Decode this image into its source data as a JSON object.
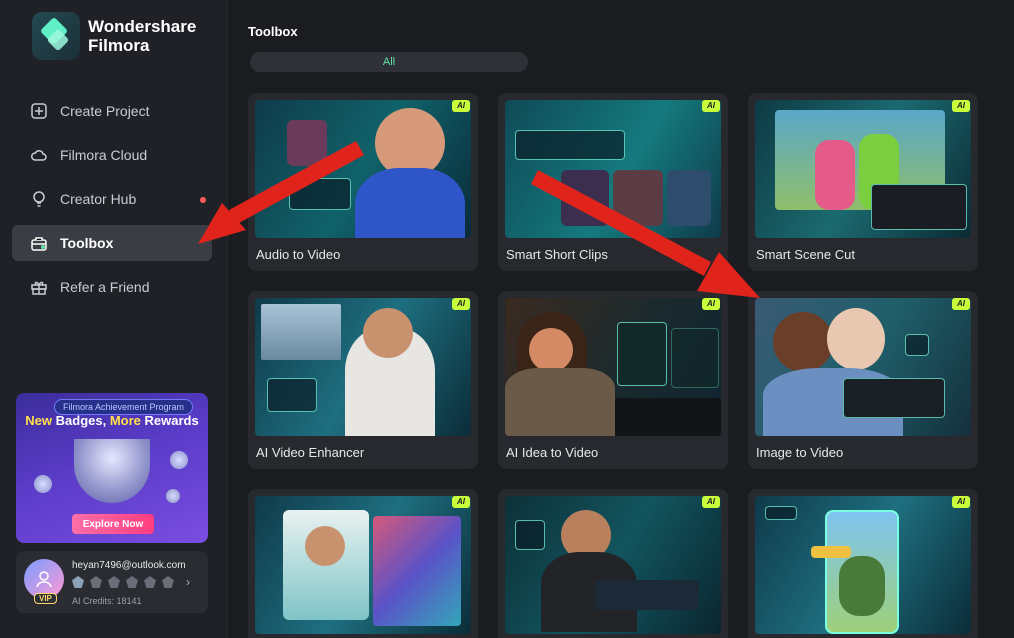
{
  "app": {
    "brand_line1": "Wondershare",
    "brand_line2": "Filmora"
  },
  "sidebar": {
    "items": [
      {
        "label": "Create Project",
        "icon": "plus-square-icon",
        "active": false
      },
      {
        "label": "Filmora Cloud",
        "icon": "cloud-icon",
        "active": false
      },
      {
        "label": "Creator Hub",
        "icon": "bulb-icon",
        "active": false,
        "notification_dot": true
      },
      {
        "label": "Toolbox",
        "icon": "toolbox-icon",
        "active": true
      },
      {
        "label": "Refer a Friend",
        "icon": "gift-icon",
        "active": false
      }
    ],
    "promo": {
      "program": "Filmora Achievement Program",
      "title_new": "New",
      "title_badges": " Badges, ",
      "title_more": "More",
      "title_rewards": " Rewards",
      "button": "Explore Now"
    },
    "account": {
      "email": "heyan7496@outlook.com",
      "badge": "VIP",
      "credits": "AI Credits: 18141"
    }
  },
  "main": {
    "title": "Toolbox",
    "filter": "All",
    "ai_badge": "AI",
    "tools": [
      {
        "label": "Audio to Video"
      },
      {
        "label": "Smart Short Clips"
      },
      {
        "label": "Smart Scene Cut"
      },
      {
        "label": "AI Video Enhancer"
      },
      {
        "label": "AI Idea to Video"
      },
      {
        "label": "Image to Video"
      },
      {
        "label": ""
      },
      {
        "label": ""
      },
      {
        "label": ""
      }
    ]
  },
  "colors": {
    "accent_green": "#5fe3a8",
    "ai_badge": "#c9ff3a",
    "annotation_arrow": "#e0241b",
    "notification_dot": "#ff5a5a"
  }
}
